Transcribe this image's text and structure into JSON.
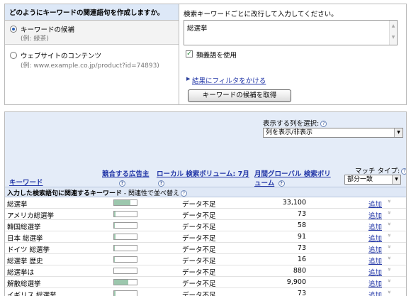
{
  "top": {
    "question": "どのようにキーワードの関連語句を作成しますか。",
    "option_keyword": {
      "label": "キーワードの候補",
      "example": "(例: 緑茶)"
    },
    "option_website": {
      "label": "ウェブサイトのコンテンツ",
      "example": "(例: www.example.co.jp/product?id=74893)"
    },
    "instructions": "検索キーワードごとに改行して入力してください。",
    "keyword_input": "総選挙",
    "synonyms_label": "類義語を使用",
    "filter_link": "結果にフィルタをかける",
    "get_button": "キーワードの候補を取得"
  },
  "results": {
    "columns_label": "表示する列を選択:",
    "columns_select": "列を表示/非表示",
    "headers": {
      "keyword": "キーワード",
      "competition": "競合する広告主",
      "local": "ローカル 検索ボリューム: 7月",
      "global": "月間グローバル 検索ボリューム"
    },
    "match_label": "マッチ タイプ:",
    "match_select": "部分一致",
    "group_title": "入力した検索語句に関連するキーワード",
    "group_sort": " - 関連性で並べ替え",
    "add_label": "追加",
    "rows": [
      {
        "keyword": "総選挙",
        "competition": 0.73,
        "local": "データ不足",
        "global": "33,100"
      },
      {
        "keyword": "アメリカ総選挙",
        "competition": 0.05,
        "local": "データ不足",
        "global": "73"
      },
      {
        "keyword": "韓国総選挙",
        "competition": 0.03,
        "local": "データ不足",
        "global": "58"
      },
      {
        "keyword": "日本 総選挙",
        "competition": 0.05,
        "local": "データ不足",
        "global": "91"
      },
      {
        "keyword": "ドイツ 総選挙",
        "competition": 0.03,
        "local": "データ不足",
        "global": "73"
      },
      {
        "keyword": "総選挙 歴史",
        "competition": 0.03,
        "local": "データ不足",
        "global": "16"
      },
      {
        "keyword": "総選挙は",
        "competition": 0.0,
        "local": "データ不足",
        "global": "880"
      },
      {
        "keyword": "解散総選挙",
        "competition": 0.62,
        "local": "データ不足",
        "global": "9,900"
      },
      {
        "keyword": "イギリス 総選挙",
        "competition": 0.05,
        "local": "データ不足",
        "global": "73"
      }
    ]
  }
}
